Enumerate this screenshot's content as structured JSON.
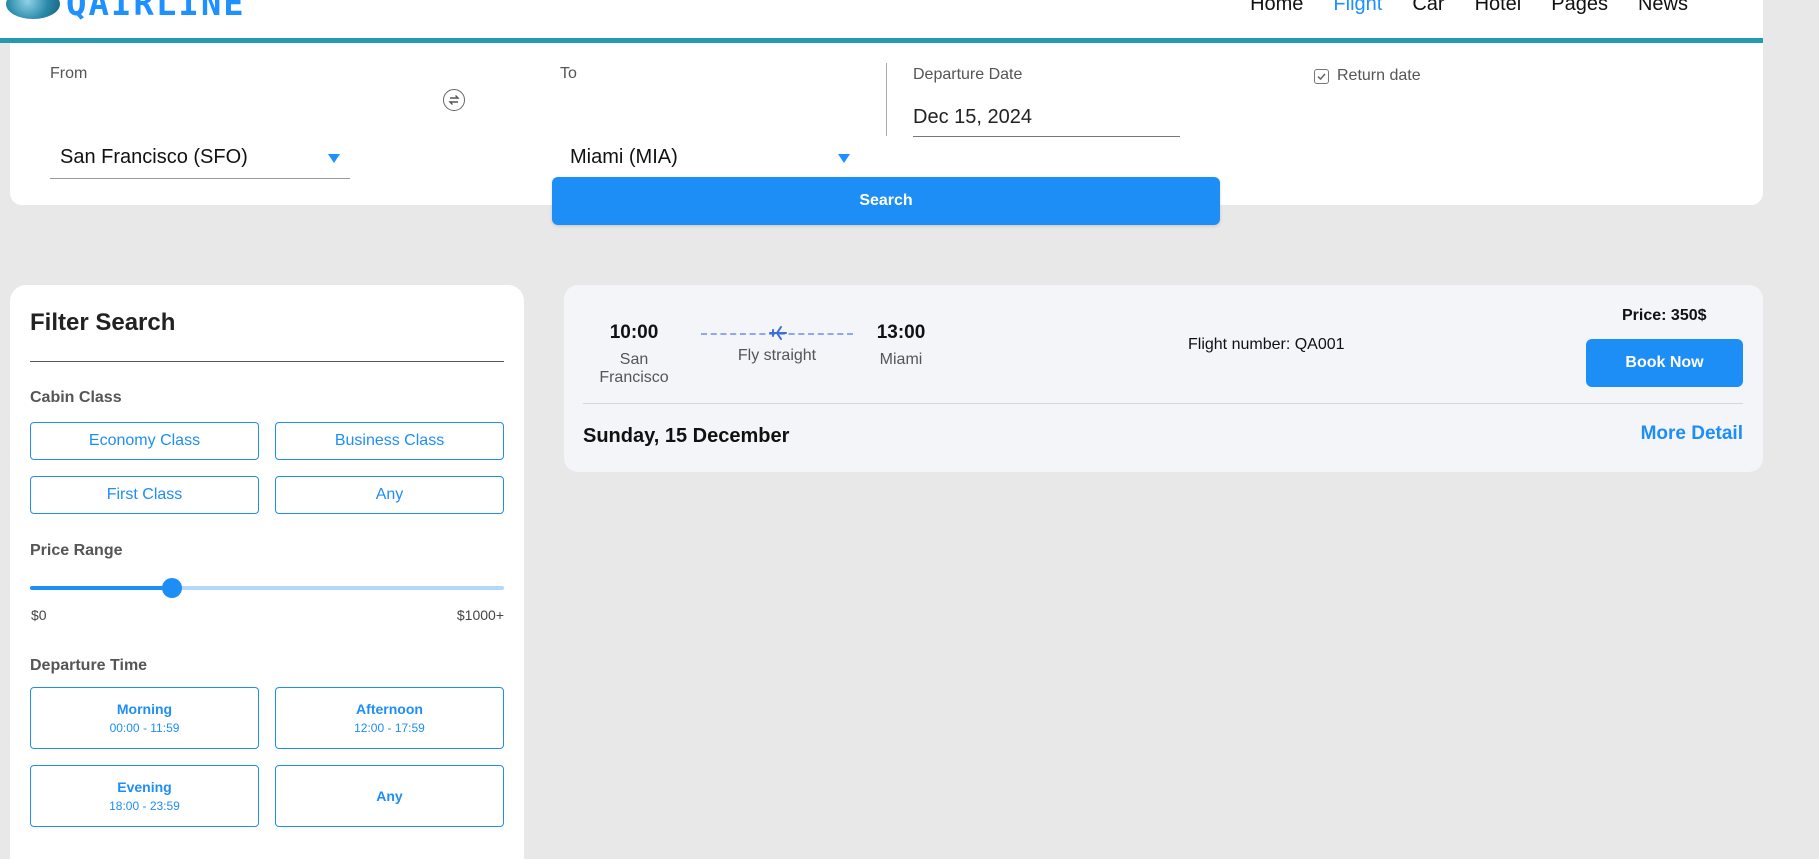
{
  "header": {
    "logo_text": "QAIRLINE",
    "nav": [
      {
        "label": "Home",
        "active": false
      },
      {
        "label": "Flight",
        "active": true
      },
      {
        "label": "Car",
        "active": false
      },
      {
        "label": "Hotel",
        "active": false
      },
      {
        "label": "Pages",
        "active": false
      },
      {
        "label": "News",
        "active": false
      }
    ],
    "accent_color": "#2499b3"
  },
  "search": {
    "from_label": "From",
    "from_value": "San Francisco (SFO)",
    "to_label": "To",
    "to_value": "Miami (MIA)",
    "departure_label": "Departure Date",
    "departure_value": "Dec 15, 2024",
    "return_label": "Return date",
    "return_checked": true,
    "search_button": "Search"
  },
  "filter": {
    "title": "Filter Search",
    "cabin_label": "Cabin Class",
    "cabin_options": [
      "Economy Class",
      "Business Class",
      "First Class",
      "Any"
    ],
    "price_label": "Price Range",
    "price_min": "$0",
    "price_max": "$1000+",
    "price_value_fraction": 0.3,
    "departure_time_label": "Departure Time",
    "departure_options": [
      {
        "name": "Morning",
        "range": "00:00 - 11:59"
      },
      {
        "name": "Afternoon",
        "range": "12:00 - 17:59"
      },
      {
        "name": "Evening",
        "range": "18:00 - 23:59"
      },
      {
        "name": "Any",
        "range": ""
      }
    ]
  },
  "flight": {
    "depart_time": "10:00",
    "depart_city": "San Francisco",
    "route_label": "Fly straight",
    "arrive_time": "13:00",
    "arrive_city": "Miami",
    "flight_number": "Flight number: QA001",
    "price": "Price: 350$",
    "book_button": "Book Now",
    "date": "Sunday, 15 December",
    "more_detail": "More Detail"
  },
  "colors": {
    "primary": "#1e8ef7",
    "background": "#e8e8e8"
  }
}
